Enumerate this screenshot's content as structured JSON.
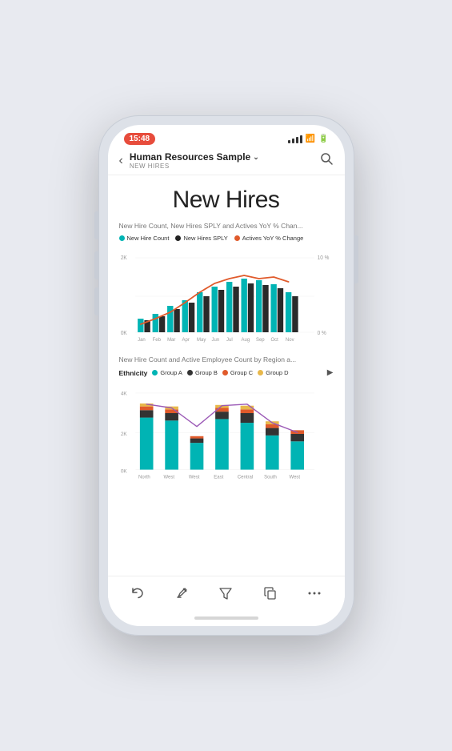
{
  "status": {
    "time": "15:48"
  },
  "nav": {
    "back_label": "‹",
    "title": "Human Resources Sample",
    "chevron": "∨",
    "subtitle": "NEW HIRES",
    "search_icon": "search"
  },
  "page": {
    "title": "New Hires"
  },
  "chart1": {
    "title": "New Hire Count, New Hires SPLY and Actives YoY % Chan...",
    "legend": [
      {
        "label": "New Hire Count",
        "color": "#00b4b4"
      },
      {
        "label": "New Hires SPLY",
        "color": "#222222"
      },
      {
        "label": "Actives YoY % Change",
        "color": "#e05a2b"
      }
    ],
    "y_left_top": "2K",
    "y_left_bottom": "0K",
    "y_right_top": "10 %",
    "y_right_bottom": "0 %",
    "x_labels": [
      "Jan",
      "Feb",
      "Mar",
      "Apr",
      "May",
      "Jun",
      "Jul",
      "Aug",
      "Sep",
      "Oct",
      "Nov"
    ]
  },
  "chart2": {
    "title": "New Hire Count and Active Employee Count by Region a...",
    "ethnicity_label": "Ethnicity",
    "legend": [
      {
        "label": "Group A",
        "color": "#00b4b4"
      },
      {
        "label": "Group B",
        "color": "#333333"
      },
      {
        "label": "Group C",
        "color": "#e05a2b"
      },
      {
        "label": "Group D",
        "color": "#e8b84b"
      }
    ],
    "y_top": "4K",
    "y_mid": "2K",
    "y_bottom": "0K",
    "x_labels": [
      "North",
      "West",
      "West",
      "East",
      "Central",
      "South",
      "West"
    ]
  },
  "toolbar": {
    "back_label": "↩",
    "highlighter_label": "✏",
    "filter_label": "⊟",
    "copy_label": "⧉",
    "more_label": "···"
  }
}
